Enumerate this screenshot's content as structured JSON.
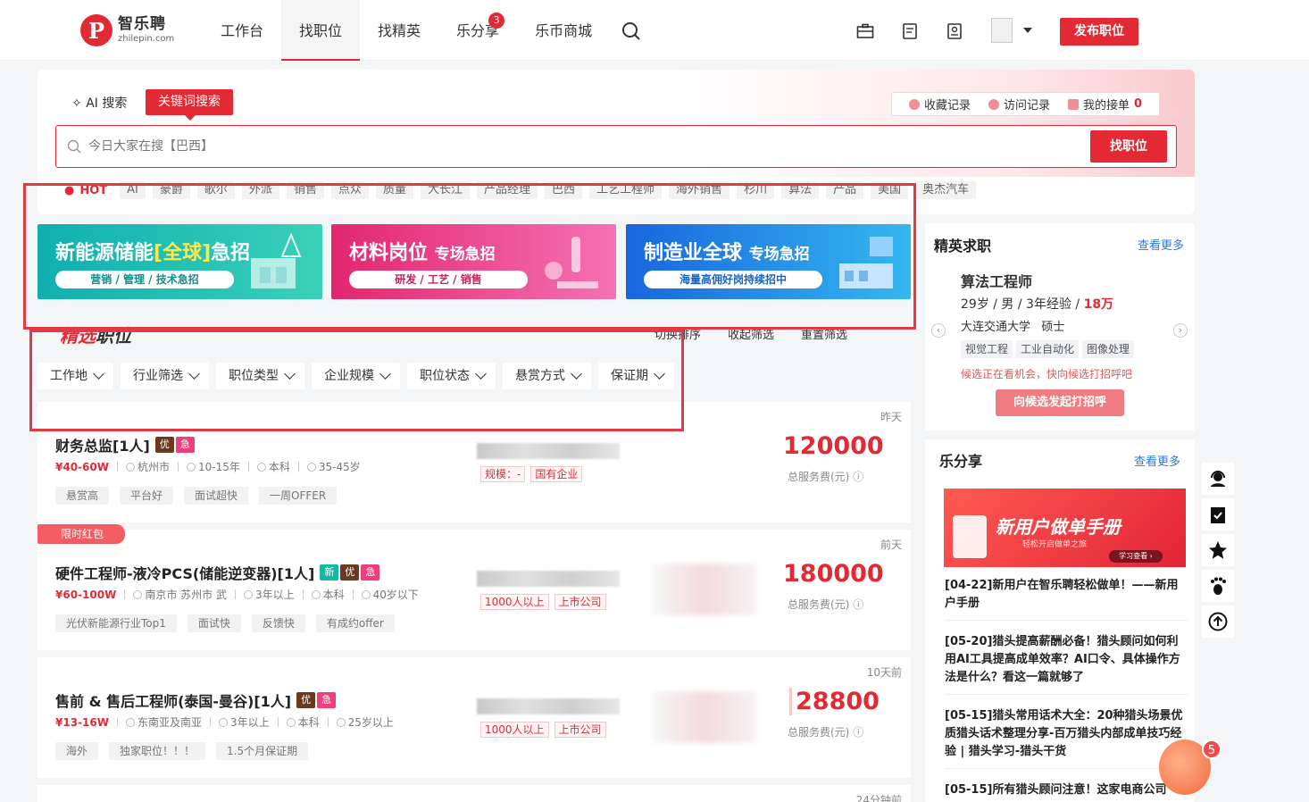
{
  "brand": {
    "name_cn": "智乐聘",
    "name_en": "zhilepin.com"
  },
  "nav": [
    {
      "label": "工作台"
    },
    {
      "label": "找职位",
      "active": true
    },
    {
      "label": "找精英"
    },
    {
      "label": "乐分享",
      "badge": "3"
    },
    {
      "label": "乐币商城"
    }
  ],
  "header": {
    "publish_label": "发布职位"
  },
  "search": {
    "ai_tab": "AI 搜索",
    "keyword_tab": "关键词搜索",
    "placeholder": "今日大家在搜【巴西】",
    "button": "找职位",
    "quick_links": [
      {
        "label": "收藏记录"
      },
      {
        "label": "访问记录"
      },
      {
        "label": "我的接单",
        "count": "0"
      }
    ],
    "hot_label": "HOT",
    "hot_tags": [
      "AI",
      "豪爵",
      "歌尔",
      "外派",
      "销售",
      "点众",
      "质量",
      "大长江",
      "产品经理",
      "巴西",
      "工艺工程师",
      "海外销售",
      "杉川",
      "算法",
      "产品",
      "美国",
      "奥杰汽车"
    ]
  },
  "banners": [
    {
      "title_a": "新能源储能",
      "title_b": "[全球]",
      "title_c": "急招",
      "subtitle": "营销 / 管理 / 技术急招",
      "color": "#18b5ae"
    },
    {
      "title_a": "材料岗位",
      "title_b": "",
      "title_c": "专场急招",
      "subtitle": "研发 / 工艺 / 销售",
      "color": "#e8327a"
    },
    {
      "title_a": "制造业全球",
      "title_b": "",
      "title_c": "专场急招",
      "subtitle": "海量高佣好岗持续招中",
      "color": "#1c79e0"
    }
  ],
  "section": {
    "title_red": "精选",
    "title_dark": "职位",
    "actions": [
      "切换排序",
      "收起筛选",
      "重置筛选"
    ],
    "filters": [
      "工作地",
      "行业筛选",
      "职位类型",
      "企业规模",
      "职位状态",
      "悬赏方式",
      "保证期"
    ]
  },
  "jobs": [
    {
      "time": "昨天",
      "title": "财务总监[1人]",
      "tags": [
        "优",
        "急"
      ],
      "salary": "¥40-60W",
      "location": "杭州市",
      "experience": "10-15年",
      "education": "本科",
      "age": "35-45岁",
      "perks": [
        "悬赏高",
        "平台好",
        "面试超快",
        "一周OFFER"
      ],
      "company_tags": [
        "规模：-",
        "国有企业"
      ],
      "fee": "120000",
      "fee_label": "总服务费(元)"
    },
    {
      "time": "前天",
      "red_packet": "限时红包",
      "title": "硬件工程师-液冷PCS(储能逆变器)[1人]",
      "tags": [
        "新",
        "优",
        "急"
      ],
      "salary": "¥60-100W",
      "location": "南京市 苏州市 武",
      "experience": "3年以上",
      "education": "本科",
      "age": "40岁以下",
      "perks": [
        "光伏新能源行业Top1",
        "面试快",
        "反馈快",
        "有成约offer"
      ],
      "company_tags": [
        "1000人以上",
        "上市公司"
      ],
      "fee": "180000",
      "fee_label": "总服务费(元)"
    },
    {
      "time": "10天前",
      "title": "售前 & 售后工程师(泰国-曼谷)[1人]",
      "tags": [
        "优",
        "急"
      ],
      "salary": "¥13-16W",
      "location": "东南亚及南亚",
      "experience": "3年以上",
      "education": "本科",
      "age": "25岁以上",
      "perks": [
        "海外",
        "独家职位！！！",
        "1.5个月保证期"
      ],
      "company_tags": [
        "1000人以上",
        "上市公司"
      ],
      "fee": "28800",
      "fee_label": "总服务费(元)"
    },
    {
      "time": "24分钟前"
    }
  ],
  "elite": {
    "heading": "精英求职",
    "more": "查看更多",
    "name": "算法工程师",
    "info": "29岁 / 男 / 3年经验 / ",
    "salary": "18万",
    "school": "大连交通大学",
    "degree": "硕士",
    "tags": [
      "视觉工程",
      "工业自动化",
      "图像处理"
    ],
    "note": "候选正在看机会，快向候选打招呼吧",
    "button": "向候选发起打招呼"
  },
  "share": {
    "heading": "乐分享",
    "more": "查看更多",
    "banner_title": "新用户做单手册",
    "banner_sub": "轻松开启做单之旅",
    "banner_btn": "学习查看 ›",
    "articles": [
      "[04-22]新用户在智乐聘轻松做单！——新用户手册",
      "[05-20]猎头提高薪酬必备！猎头顾问如何利用AI工具提高成单效率？AI口令、具体操作方法是什么？看这一篇就够了",
      "[05-15]猎头常用话术大全：20种猎头场景优质猎头话术整理分享-百万猎头内部成单技巧经验 | 猎头学习-猎头干货",
      "[05-15]所有猎头顾问注意！这家电商公司"
    ]
  },
  "mascot_badge": "5",
  "colors": {
    "brand": "#e32a34",
    "link": "#2c7ae0"
  }
}
